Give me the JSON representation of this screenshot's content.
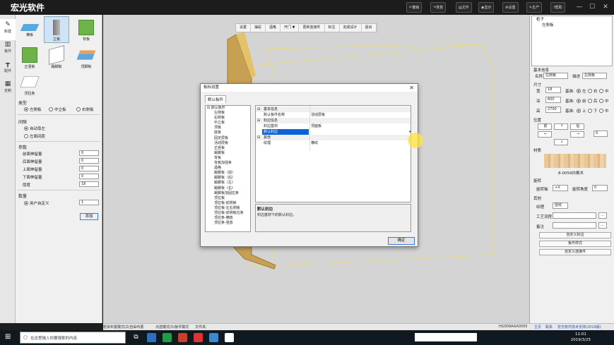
{
  "app": {
    "title": "宏光软件",
    "toolbar": [
      "撤销",
      "恢复",
      "文件",
      "显示",
      "设置",
      "生产",
      "帮助"
    ],
    "window_controls": [
      "—",
      "☐",
      "✕"
    ]
  },
  "left_tabs": [
    {
      "label": "新建",
      "icon": "pencil-icon"
    },
    {
      "label": "板件",
      "icon": "board-icon"
    },
    {
      "label": "配件",
      "icon": "hardware-icon"
    },
    {
      "label": "定制",
      "icon": "grid-icon"
    }
  ],
  "board_types": [
    {
      "label": "横板",
      "color": "#5aa8e0"
    },
    {
      "label": "立板",
      "color": "#9aa0a8"
    },
    {
      "label": "背板",
      "color": "#6db34a"
    },
    {
      "label": "正竖板",
      "color": "#6db34a"
    },
    {
      "label": "踢脚板",
      "color": "#d8d8d8"
    },
    {
      "label": "顶脚板",
      "color": "#e8a060"
    },
    {
      "label": "顶拉条",
      "color": "#cccccc"
    }
  ],
  "type_section": {
    "title": "类型",
    "options": [
      "左侧板",
      "中立板",
      "右侧板"
    ],
    "selected": "左侧板"
  },
  "gap_section": {
    "title": "间隙",
    "options": [
      "自动靠左",
      "左面间距"
    ],
    "selected": "自动靠左"
  },
  "params_section": {
    "title": "参数",
    "fields": [
      {
        "label": "前面伸留量",
        "value": "0"
      },
      {
        "label": "后面伸留量",
        "value": "0"
      },
      {
        "label": "上面伸留量",
        "value": "0"
      },
      {
        "label": "下面伸留量",
        "value": "0"
      },
      {
        "label": "厚度",
        "value": "18"
      }
    ]
  },
  "quantity_section": {
    "title": "数量",
    "option": "用户自定义",
    "value": "1",
    "add_button": "添加"
  },
  "viewport_toolbar": [
    "设置",
    "抽屉",
    "酒格",
    "开门 ▼",
    "更新连接件",
    "标注",
    "完成设计",
    "退出"
  ],
  "right_panel": {
    "tree": [
      "柜子",
      "左侧板"
    ],
    "basic_info_title": "基本信息",
    "name_label": "名称",
    "name_value": "左侧板",
    "desc_label": "描述",
    "desc_value": "左侧板",
    "size_title": "尺寸",
    "dims": [
      {
        "label": "宽",
        "value": "18",
        "base": "基准:",
        "opts": [
          "左",
          "右",
          "中"
        ],
        "sel": "左"
      },
      {
        "label": "深",
        "value": "600",
        "base": "基准:",
        "opts": [
          "前",
          "后",
          "中"
        ],
        "sel": "前"
      },
      {
        "label": "高",
        "value": "2700",
        "base": "基准:",
        "opts": [
          "上",
          "下",
          "中"
        ],
        "sel": "上"
      }
    ],
    "position_title": "位置",
    "pos_buttons": [
      "前",
      "↑",
      "后",
      "←",
      "→",
      "↓"
    ],
    "pos_value": "0",
    "material_title": "材质",
    "material_name": "8-0059白枫木",
    "rotate_title": "旋转",
    "rotate_axis_label": "旋转轴",
    "rotate_axis_value": "+X",
    "rotate_angle_label": "旋转角度",
    "rotate_angle_value": "0",
    "other_title": "其他",
    "grain_label": "纹理",
    "grain_value": "竖纹",
    "process_label": "工艺流程",
    "note_label": "备注",
    "buttons": [
      "自定义封边",
      "板件样式",
      "自定义连接件"
    ]
  },
  "status_bar": [
    "柜体布置模式(Z)自由布置",
    "点选模式(S)板件模式",
    "文件夹:"
  ],
  "status_right": [
    "HG009AAA0005",
    "主页",
    "联系",
    "宏光软件技术支持(2019版)"
  ],
  "taskbar": {
    "search_placeholder": "在这里输入你要搜索的内容",
    "time": "11:01",
    "date": "2019/3/25"
  },
  "dialog": {
    "title": "板标设置",
    "close": "✕",
    "tab": "默认板件",
    "tree_root": "默认板件",
    "tree_items": [
      "左侧板",
      "右侧板",
      "中立板",
      "顶板",
      "底板",
      "固定层板",
      "活动层板",
      "正竖板",
      "踢脚板",
      "背板",
      "背板加强条",
      "酒格",
      "踢脚板（前）",
      "踢脚板（后）",
      "踢脚板（左）",
      "踢脚板（右）",
      "踢脚板加固拉条",
      "顶拉板",
      "顶拉板-前侧板",
      "顶拉板-左右侧板",
      "顶拉板-前侧板拉条",
      "顶拉条-横放",
      "顶拉条-竖放"
    ],
    "grid_rows": [
      {
        "cat": true,
        "k": "基本信息",
        "v": ""
      },
      {
        "cat": false,
        "k": "默认板件名称",
        "v": "活动层板"
      },
      {
        "cat": true,
        "k": "封边信息",
        "v": ""
      },
      {
        "cat": false,
        "k": "封边基材",
        "v": "顶面板"
      },
      {
        "cat": false,
        "k": "默认封边",
        "v": "",
        "selected": true
      },
      {
        "cat": true,
        "k": "其他",
        "v": ""
      },
      {
        "cat": false,
        "k": "纹理",
        "v": "横纹"
      }
    ],
    "desc_title": "默认封边",
    "desc_text": "封边基材下的默认封边。",
    "ok_button": "确定"
  }
}
